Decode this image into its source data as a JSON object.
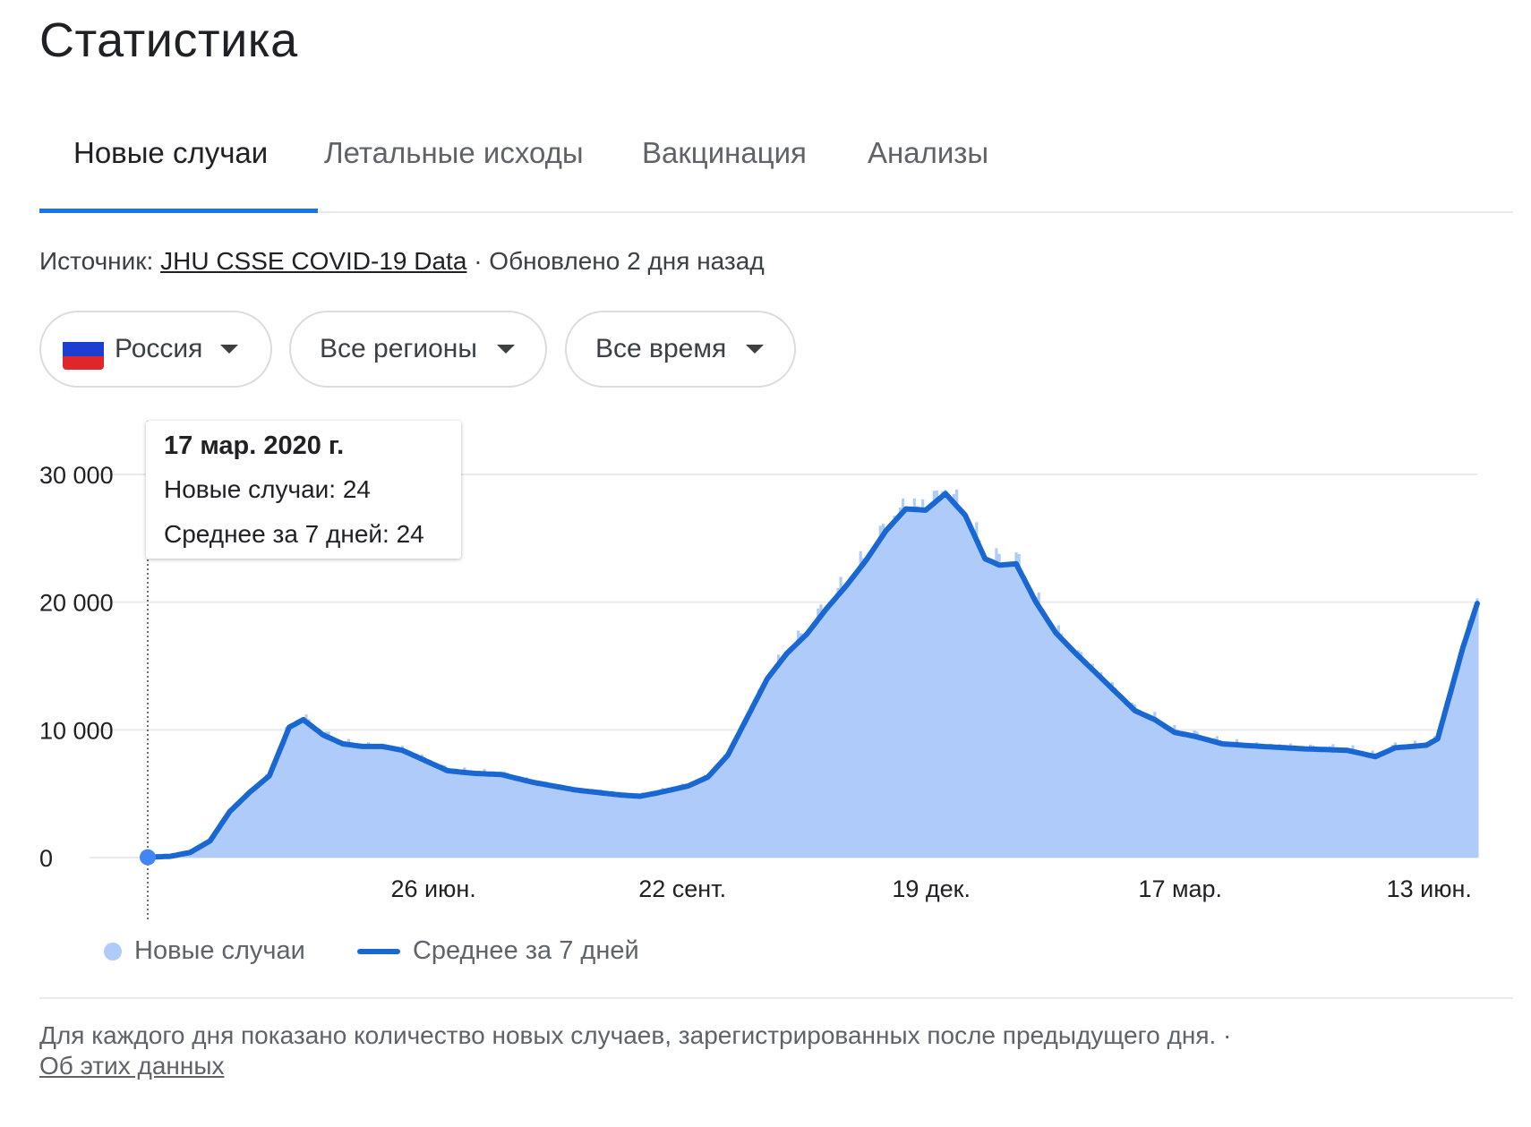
{
  "page": {
    "title": "Статистика"
  },
  "tabs": [
    {
      "label": "Новые случаи",
      "active": true
    },
    {
      "label": "Летальные исходы",
      "active": false
    },
    {
      "label": "Вакцинация",
      "active": false
    },
    {
      "label": "Анализы",
      "active": false
    }
  ],
  "source": {
    "prefix": "Источник:",
    "link": "JHU CSSE COVID-19 Data",
    "updated": "· Обновлено 2 дня назад"
  },
  "filters": {
    "country": "Россия",
    "region": "Все регионы",
    "period": "Все время"
  },
  "tooltip": {
    "date": "17 мар. 2020 г.",
    "new_cases": "Новые случаи: 24",
    "avg7": "Среднее за 7 дней: 24"
  },
  "legend": {
    "bars": "Новые случаи",
    "line": "Среднее за 7 дней"
  },
  "footnote": {
    "text": "Для каждого дня показано количество новых случаев, зарегистрированных после предыдущего дня.",
    "sep": " · ",
    "link": "Об этих данных"
  },
  "colors": {
    "bar": "#aecbfa",
    "line": "#1967d2",
    "accent": "#1a73e8",
    "grid": "#e8eaed"
  },
  "chart_data": {
    "type": "area",
    "title": "",
    "xlabel": "",
    "ylabel": "",
    "ylim": [
      0,
      30000
    ],
    "yticks": [
      "0",
      "10 000",
      "20 000",
      "30 000"
    ],
    "xticks": [
      {
        "label": "26 июн.",
        "date": "2020-06-26"
      },
      {
        "label": "22 сент.",
        "date": "2020-09-22"
      },
      {
        "label": "19 дек.",
        "date": "2020-12-19"
      },
      {
        "label": "17 мар.",
        "date": "2021-03-17"
      },
      {
        "label": "13 июн.",
        "date": "2021-06-13"
      }
    ],
    "grid": true,
    "x_range": [
      "2020-03-17",
      "2021-06-30"
    ],
    "highlight": {
      "date": "2020-03-17",
      "value": 24
    },
    "series": [
      {
        "name": "Среднее за 7 дней",
        "kind": "line",
        "points": [
          [
            "2020-03-17",
            24
          ],
          [
            "2020-03-25",
            100
          ],
          [
            "2020-04-01",
            400
          ],
          [
            "2020-04-08",
            1300
          ],
          [
            "2020-04-15",
            3600
          ],
          [
            "2020-04-22",
            5100
          ],
          [
            "2020-04-29",
            6400
          ],
          [
            "2020-05-06",
            10200
          ],
          [
            "2020-05-11",
            10800
          ],
          [
            "2020-05-18",
            9600
          ],
          [
            "2020-05-25",
            8900
          ],
          [
            "2020-06-01",
            8700
          ],
          [
            "2020-06-08",
            8700
          ],
          [
            "2020-06-15",
            8400
          ],
          [
            "2020-06-22",
            7700
          ],
          [
            "2020-07-01",
            6800
          ],
          [
            "2020-07-10",
            6600
          ],
          [
            "2020-07-20",
            6500
          ],
          [
            "2020-07-31",
            5900
          ],
          [
            "2020-08-15",
            5300
          ],
          [
            "2020-08-31",
            4900
          ],
          [
            "2020-09-07",
            4800
          ],
          [
            "2020-09-14",
            5100
          ],
          [
            "2020-09-24",
            5600
          ],
          [
            "2020-10-01",
            6300
          ],
          [
            "2020-10-08",
            8000
          ],
          [
            "2020-10-15",
            11000
          ],
          [
            "2020-10-22",
            14000
          ],
          [
            "2020-10-29",
            16000
          ],
          [
            "2020-11-05",
            17500
          ],
          [
            "2020-11-12",
            19500
          ],
          [
            "2020-11-19",
            21300
          ],
          [
            "2020-11-26",
            23300
          ],
          [
            "2020-12-03",
            25600
          ],
          [
            "2020-12-10",
            27300
          ],
          [
            "2020-12-17",
            27200
          ],
          [
            "2020-12-24",
            28500
          ],
          [
            "2020-12-31",
            26800
          ],
          [
            "2021-01-07",
            23400
          ],
          [
            "2021-01-12",
            22900
          ],
          [
            "2021-01-18",
            23000
          ],
          [
            "2021-01-25",
            20000
          ],
          [
            "2021-02-01",
            17600
          ],
          [
            "2021-02-08",
            16000
          ],
          [
            "2021-02-15",
            14500
          ],
          [
            "2021-02-22",
            13000
          ],
          [
            "2021-03-01",
            11500
          ],
          [
            "2021-03-08",
            10800
          ],
          [
            "2021-03-15",
            9800
          ],
          [
            "2021-03-22",
            9500
          ],
          [
            "2021-04-01",
            8900
          ],
          [
            "2021-04-15",
            8700
          ],
          [
            "2021-05-01",
            8500
          ],
          [
            "2021-05-15",
            8400
          ],
          [
            "2021-05-25",
            7900
          ],
          [
            "2021-06-01",
            8600
          ],
          [
            "2021-06-07",
            8700
          ],
          [
            "2021-06-12",
            8800
          ],
          [
            "2021-06-16",
            9300
          ],
          [
            "2021-06-20",
            12500
          ],
          [
            "2021-06-25",
            16500
          ],
          [
            "2021-06-30",
            19900
          ]
        ]
      },
      {
        "name": "Новые случаи",
        "kind": "bar",
        "note": "daily bars follow the 7-day average with minor day-to-day noise"
      }
    ]
  }
}
